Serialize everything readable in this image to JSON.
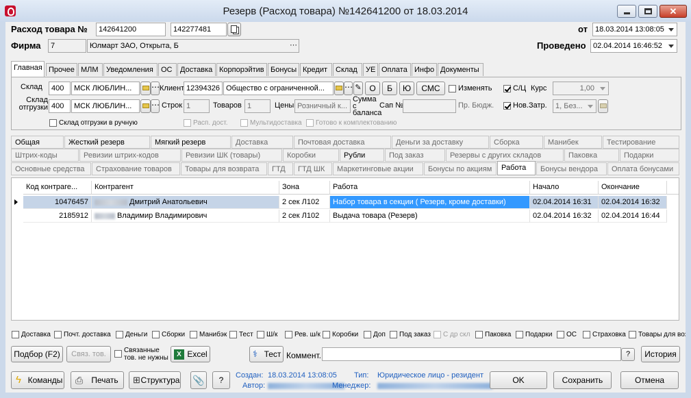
{
  "window": {
    "title": "Резерв (Расход товара) №142641200 от 18.03.2014"
  },
  "header": {
    "doc_label": "Расход товара №",
    "doc_no": "142641200",
    "doc_no2": "142277481",
    "from_label": "от",
    "from_date": "18.03.2014 13:08:05",
    "firm_label": "Фирма",
    "firm_code": "7",
    "firm_name": "Юлмарт ЗАО, Открыта, Б",
    "posted_label": "Проведено",
    "posted_date": "02.04.2014 16:46:52"
  },
  "main_tabs": [
    "Главная",
    "Прочее",
    "МЛМ",
    "Уведомления",
    "ОС",
    "Доставка",
    "Корпорэйтив",
    "Бонусы",
    "Кредит",
    "Склад",
    "УЕ",
    "Оплата",
    "Инфо",
    "Документы"
  ],
  "main_tab_selected": "Главная",
  "panel": {
    "warehouse_label": "Склад",
    "warehouse_code": "400",
    "warehouse_name": "МСК ЛЮБЛИН...",
    "ship_wh_label": "Склад отгрузки",
    "ship_wh_code": "400",
    "ship_wh_name": "МСК ЛЮБЛИН...",
    "client_label": "Клиент",
    "client_code": "12394326",
    "client_name": "Общество с ограниченной...",
    "btn_o": "О",
    "btn_b": "Б",
    "btn_yu": "Ю",
    "btn_sms": "СМС",
    "change_label": "Изменять",
    "sc_label": "С/Ц",
    "rate_label": "Курс",
    "rate_value": "1,00",
    "rows_label": "Строк",
    "rows_value": "1",
    "goods_label": "Товаров",
    "goods_value": "1",
    "prices_label": "Цены",
    "prices_value": "Розничный к...",
    "balance_label": "Сумма с баланса",
    "sap_label": "Сап №",
    "budget_label": "Пр. Бюдж.",
    "newcost_label": "Нов.Затр.",
    "newcost_value": "1, Без...",
    "manual_ship_label": "Склад отгрузки в ручную",
    "calc_label": "Расп. дост.",
    "multi_label": "Мультидоставка",
    "ready_label": "Готово к комплектованию"
  },
  "sub_tabs": {
    "row1": [
      "Общая",
      "Жесткий резерв",
      "Мягкий резерв",
      "Доставка",
      "Почтовая доставка",
      "Деньги за доставку",
      "Сборка",
      "Манибек",
      "Тестирование"
    ],
    "row2": [
      "Штрих-коды",
      "Ревизии штрих-кодов",
      "Ревизии ШК (товары)",
      "Коробки",
      "Рубли",
      "Под заказ",
      "Резервы с других складов",
      "Паковка",
      "Подарки"
    ],
    "row3": [
      "Основные средства",
      "Страхование товаров",
      "Товары для возврата",
      "ГТД",
      "ГТД ШК",
      "Маркетинговые акции",
      "Бонусы по акциям",
      "Работа",
      "Бонусы вендора",
      "Оплата бонусами"
    ]
  },
  "grid": {
    "columns": [
      "Код контраге...",
      "Контрагент",
      "Зона",
      "Работа",
      "Начало",
      "Окончание"
    ],
    "rows": [
      {
        "code": "10476457",
        "contractor": "Дмитрий Анатольевич",
        "zone": "2 сек Л102",
        "work": "Набор товара в секции ( Резерв, кроме доставки)",
        "start": "02.04.2014 16:31",
        "end": "02.04.2014 16:32"
      },
      {
        "code": "2185912",
        "contractor": "Владимир Владимирович",
        "zone": "2 сек Л102",
        "work": "Выдача товара (Резерв)",
        "start": "02.04.2014 16:32",
        "end": "02.04.2014 16:44"
      }
    ]
  },
  "filters": [
    "Доставка",
    "Почт. доставка",
    "Деньги",
    "Сборки",
    "Манибэк",
    "Тест",
    "Ш/к",
    "Рев. ш/к",
    "Коробки",
    "Доп",
    "Под заказ",
    "С др скл",
    "Паковка",
    "Подарки",
    "ОС",
    "Страховка",
    "Товары для возв"
  ],
  "actions": {
    "pick_btn": "Подбор (F2)",
    "link_btn": "Связ. тов.",
    "linked_label": "Связанные тов. не нужны",
    "excel_btn": "Excel",
    "test_btn": "Тест",
    "comment_label": "Коммент.",
    "help_btn": "?",
    "history_btn": "История"
  },
  "footer": {
    "commands_btn": "Команды",
    "print_btn": "Печать",
    "structure_btn": "Структура",
    "help_btn": "?",
    "created_label": "Создан:",
    "created_value": "18.03.2014 13:08:05",
    "type_label": "Тип:",
    "type_value": "Юридическое лицо - резидент",
    "author_label": "Автор:",
    "manager_label": "Менеджер:",
    "ok_btn": "OK",
    "save_btn": "Сохранить",
    "cancel_btn": "Отмена"
  },
  "colors": {
    "selection": "#3399ff",
    "title_bg": "#ccd9ea",
    "link_blue": "#1f5fbf"
  }
}
